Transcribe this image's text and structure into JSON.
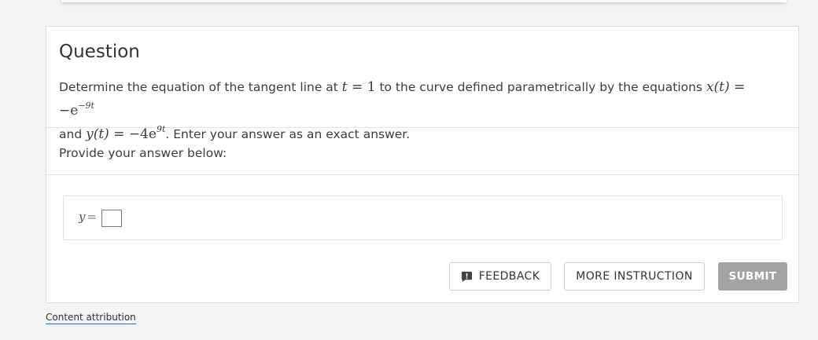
{
  "question": {
    "title": "Question",
    "line1_prefix": "Determine the equation of the tangent line at ",
    "t_var": "t",
    "t_eq": " = 1",
    "line1_mid": " to the curve defined parametrically by the equations ",
    "x_func": "x(t)",
    "x_eq": " = −e",
    "x_exp": "−9t",
    "line2_prefix": "and ",
    "y_func": "y(t)",
    "y_eq": " = −4e",
    "y_exp": "9t",
    "line2_suffix": ". Enter your answer as an exact answer."
  },
  "answer": {
    "prompt": "Provide your answer below:",
    "y_label": "y",
    "eq_sign": "=",
    "value": ""
  },
  "buttons": {
    "feedback": "FEEDBACK",
    "more_instruction": "MORE INSTRUCTION",
    "submit": "SUBMIT"
  },
  "footer": {
    "attribution": "Content attribution"
  },
  "icons": {
    "feedback": "feedback-icon"
  },
  "colors": {
    "submit_bg": "#a3a3a3",
    "link_underline": "#2b6cb0"
  }
}
